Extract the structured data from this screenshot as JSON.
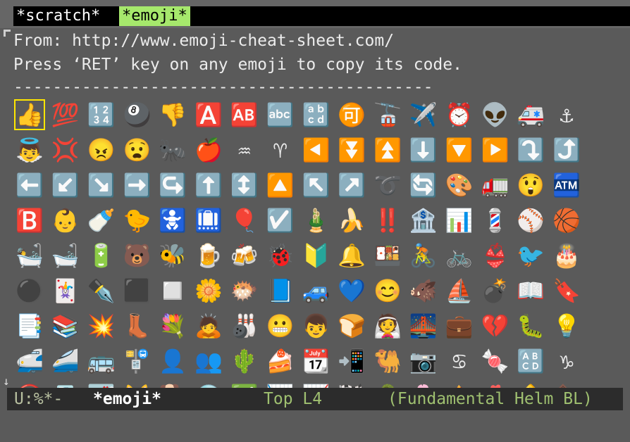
{
  "tabs": [
    {
      "label": "*scratch*",
      "active": false
    },
    {
      "label": "*emoji*",
      "active": true
    }
  ],
  "buffer": {
    "line1": "From: http://www.emoji-cheat-sheet.com/",
    "line2": "Press ‘RET’ key on any emoji to copy its code.",
    "line3": "-------------------------------------------"
  },
  "emoji_rows": [
    [
      "👍",
      "💯",
      "🔢",
      "🎱",
      "👎",
      "🅰️",
      "🆎",
      "🔤",
      "🔡",
      "🉑",
      "🚡",
      "✈️",
      "⏰",
      "👽",
      "🚑",
      "⚓"
    ],
    [
      "👼",
      "💢",
      "😠",
      "😧",
      "🐜",
      "🍎",
      "♒",
      "♈",
      "◀️",
      "⏬",
      "⏫",
      "⬇️",
      "🔽",
      "▶️",
      "⤵️",
      "⤴️"
    ],
    [
      "⬅️",
      "↙️",
      "↘️",
      "➡️",
      "↪️",
      "⬆️",
      "↕️",
      "🔼",
      "↖️",
      "↗️",
      "➰",
      "🔄",
      "🎨",
      "🚛",
      "😲",
      "🏧"
    ],
    [
      "🅱️",
      "👶",
      "🍼",
      "🐤",
      "🚼",
      "🛄",
      "🎈",
      "☑️",
      "🎍",
      "🍌",
      "‼️",
      "🏦",
      "📊",
      "💈",
      "⚾",
      "🏀"
    ],
    [
      "🛀",
      "🛁",
      "🔋",
      "🐻",
      "🐝",
      "🍺",
      "🍻",
      "🐞",
      "🔰",
      "🔔",
      "🍱",
      "🚴",
      "🚲",
      "👙",
      "🐦",
      "🎂"
    ],
    [
      "⚫",
      "🃏",
      "✒️",
      "⬛",
      "◻️",
      "🌼",
      "🐡",
      "📘",
      "🚙",
      "💙",
      "😊",
      "🐗",
      "⛵",
      "💣",
      "📖",
      "🔖"
    ],
    [
      "📑",
      "📚",
      "💥",
      "👢",
      "💐",
      "🙇",
      "🎳",
      "😬",
      "👦",
      "🍞",
      "👰",
      "🌉",
      "💼",
      "💔",
      "🐛",
      "💡"
    ],
    [
      "🚅",
      "🚄",
      "🚌",
      "🚏",
      "👤",
      "👥",
      "🌵",
      "🍰",
      "📆",
      "📲",
      "🐫",
      "📷",
      "♋",
      "🍬",
      "🔠",
      "♑"
    ],
    [
      "🚫",
      "📇",
      "🌁",
      "🐱",
      "🐕",
      "💿",
      "✅",
      "📉",
      "📈",
      "🏁",
      "🐊",
      "🌸",
      "🌰",
      "🐔",
      "🚸",
      "🍫"
    ]
  ],
  "modeline": {
    "status": "U:%*-",
    "buffer_name": "*emoji*",
    "position": "Top L4",
    "modes": "(Fundamental Helm BL)"
  }
}
